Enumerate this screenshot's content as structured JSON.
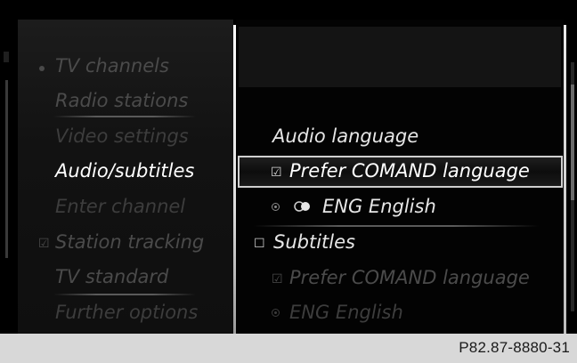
{
  "left_menu": {
    "items": [
      {
        "label": "TV channels",
        "state": "dim",
        "marker": "bullet"
      },
      {
        "label": "Radio stations",
        "state": "dim"
      },
      {
        "label": "Video settings",
        "state": "ddim"
      },
      {
        "label": "Audio/subtitles",
        "state": "active"
      },
      {
        "label": "Enter channel",
        "state": "ddim"
      },
      {
        "label": "Station tracking",
        "state": "dim",
        "marker": "checkbox-checked"
      },
      {
        "label": "TV standard",
        "state": "dim"
      },
      {
        "label": "Further options",
        "state": "ddim"
      }
    ]
  },
  "right_menu": {
    "section_title": "Audio language",
    "prefer_audio": {
      "label": "Prefer COMAND language",
      "checked": true,
      "selected": true
    },
    "audio_language": {
      "label": "ENG English",
      "icon": "language-toggle-icon"
    },
    "subtitles": {
      "label": "Subtitles",
      "checked": false
    },
    "prefer_subtitles": {
      "label": "Prefer COMAND language",
      "checked": true,
      "enabled": false
    },
    "subtitle_language": {
      "label": "ENG English",
      "enabled": false
    }
  },
  "footer": {
    "code": "P82.87-8880-31"
  },
  "colors": {
    "background": "#000000",
    "active_text": "#ffffff",
    "dim_text": "#4b4b4b",
    "footer_bg": "#d8d8d8"
  }
}
